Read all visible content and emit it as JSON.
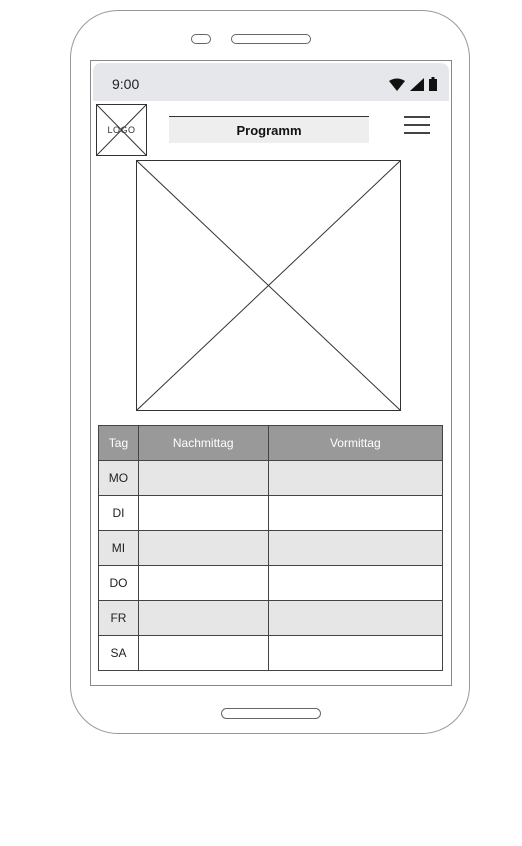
{
  "status_bar": {
    "time": "9:00",
    "icons": [
      "wifi-icon",
      "signal-icon",
      "battery-icon"
    ]
  },
  "header": {
    "logo_label": "LOGO",
    "title": "Programm",
    "menu_icon": "hamburger-menu-icon"
  },
  "schedule": {
    "columns": [
      "Tag",
      "Nachmittag",
      "Vormittag"
    ],
    "rows": [
      {
        "day": "MO",
        "nachmittag": "",
        "vormittag": ""
      },
      {
        "day": "DI",
        "nachmittag": "",
        "vormittag": ""
      },
      {
        "day": "MI",
        "nachmittag": "",
        "vormittag": ""
      },
      {
        "day": "DO",
        "nachmittag": "",
        "vormittag": ""
      },
      {
        "day": "FR",
        "nachmittag": "",
        "vormittag": ""
      },
      {
        "day": "SA",
        "nachmittag": "",
        "vormittag": ""
      }
    ]
  },
  "colors": {
    "header_cell": "#999999",
    "shaded_row": "#e6e6e6",
    "status_bar": "#e5e7ea"
  }
}
